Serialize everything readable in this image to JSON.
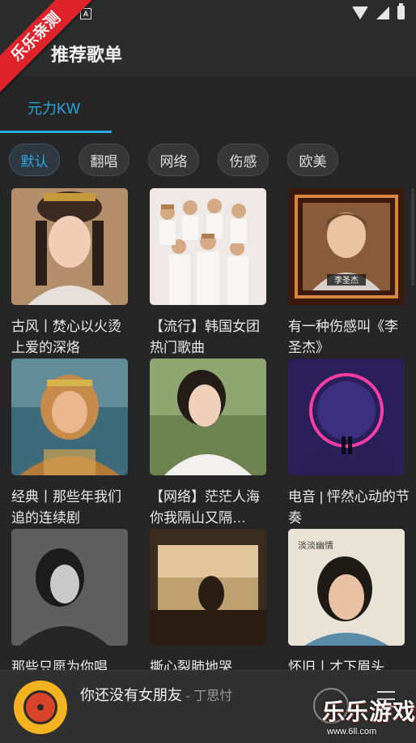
{
  "status": {
    "notif_badge": "A"
  },
  "ribbon": {
    "label": "乐乐亲测"
  },
  "header": {
    "title": "推荐歌单"
  },
  "tabs": [
    {
      "label": "元力KW",
      "active": true
    }
  ],
  "chips": [
    {
      "label": "默认",
      "active": true
    },
    {
      "label": "翻唱",
      "active": false
    },
    {
      "label": "网络",
      "active": false
    },
    {
      "label": "伤感",
      "active": false
    },
    {
      "label": "欧美",
      "active": false
    }
  ],
  "playlists": [
    {
      "title": "古风丨焚心以火烫上爱的深烙",
      "cover": "portrait-costume"
    },
    {
      "title": "【流行】韩国女团热门歌曲",
      "cover": "girl-group"
    },
    {
      "title": "有一种伤感叫《李圣杰》",
      "cover": "singer-frame",
      "cover_caption": "李圣杰"
    },
    {
      "title": "经典丨那些年我们追的连续剧",
      "cover": "monkey-king"
    },
    {
      "title": "【网络】茫茫人海 你我隔山又隔…",
      "cover": "short-hair-woman"
    },
    {
      "title": "电音 | 怦然心动的节奏",
      "cover": "neon-portal"
    },
    {
      "title": "那些只愿为你唱",
      "cover": "bw-woman"
    },
    {
      "title": "撕心裂肺地哭…",
      "cover": "sepia-window"
    },
    {
      "title": "怀旧丨才下眉头",
      "cover": "retro-poster",
      "cover_caption": "淡淡幽情"
    }
  ],
  "player": {
    "song": "你还没有女朋友",
    "separator": " - ",
    "artist": "丁思忖"
  },
  "watermark": {
    "text": "乐乐游戏",
    "url": "www.6ll.com"
  },
  "colors": {
    "accent": "#2aa6de",
    "background": "#262626",
    "ribbon": "#e0232a"
  }
}
